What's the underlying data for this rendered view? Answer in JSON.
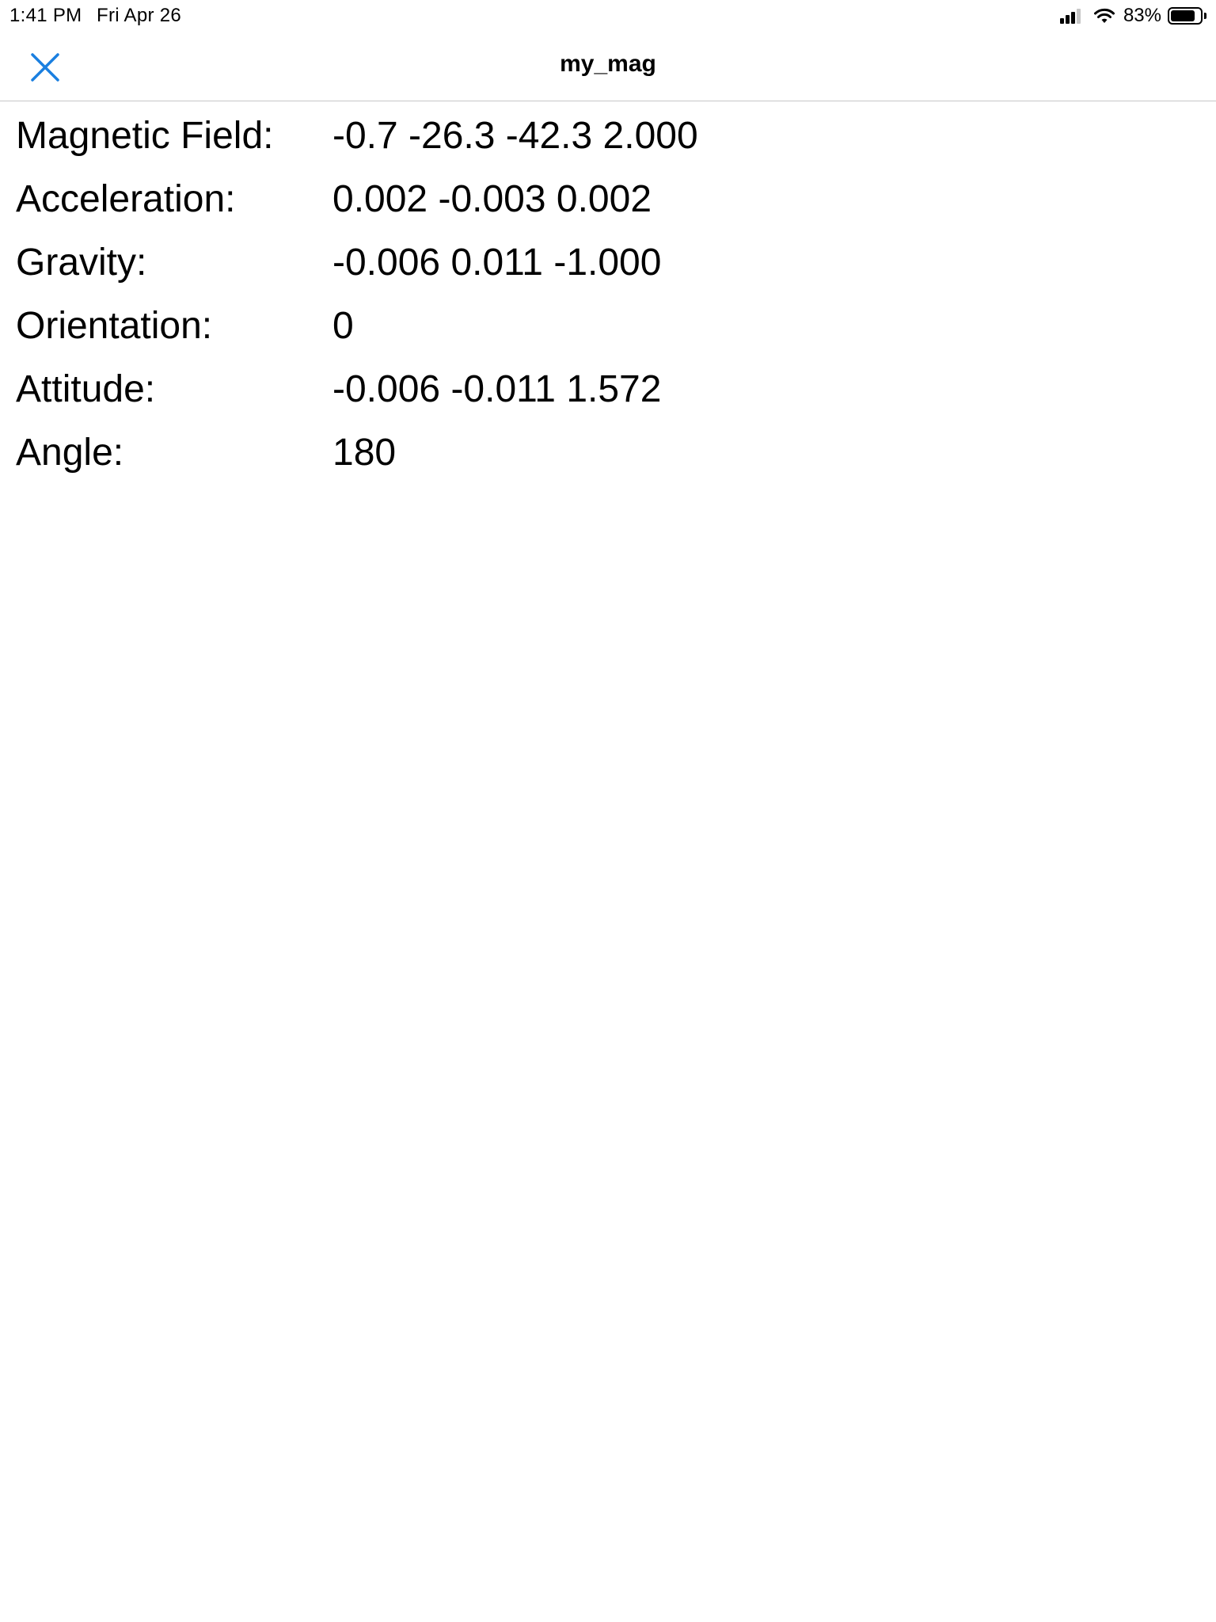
{
  "status_bar": {
    "time": "1:41 PM",
    "date": "Fri Apr 26",
    "battery_percent_text": "83%",
    "battery_level": 0.83,
    "signal_bars": 3,
    "icons": [
      "signal-icon",
      "wifi-icon",
      "battery-icon"
    ]
  },
  "nav": {
    "title": "my_mag",
    "close_icon": "close-icon",
    "accent_color": "#1a7fe0"
  },
  "readings": [
    {
      "label": "Magnetic Field:",
      "value": "-0.7 -26.3 -42.3 2.000"
    },
    {
      "label": "Acceleration:",
      "value": "0.002 -0.003 0.002"
    },
    {
      "label": "Gravity:",
      "value": "-0.006 0.011 -1.000"
    },
    {
      "label": "Orientation:",
      "value": "0"
    },
    {
      "label": "Attitude:",
      "value": "-0.006 -0.011 1.572"
    },
    {
      "label": "Angle:",
      "value": "180"
    }
  ]
}
